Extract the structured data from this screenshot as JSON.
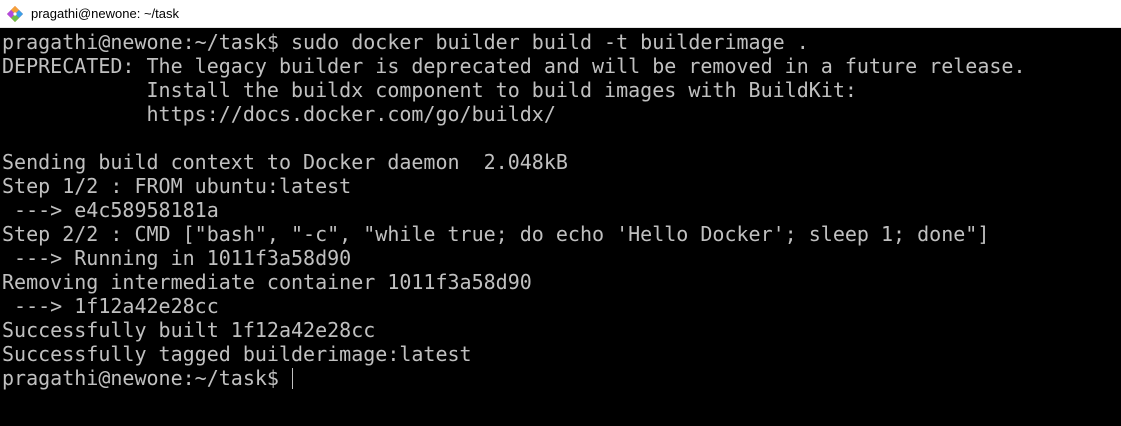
{
  "window": {
    "title": "pragathi@newone: ~/task",
    "icon": "git-bash-diamond-icon",
    "colors": {
      "background": "#000000",
      "text": "#c0c0c0",
      "titlebar": "#ffffff"
    }
  },
  "terminal": {
    "lines": [
      "pragathi@newone:~/task$ sudo docker builder build -t builderimage .",
      "DEPRECATED: The legacy builder is deprecated and will be removed in a future release.",
      "            Install the buildx component to build images with BuildKit:",
      "            https://docs.docker.com/go/buildx/",
      "",
      "Sending build context to Docker daemon  2.048kB",
      "Step 1/2 : FROM ubuntu:latest",
      " ---> e4c58958181a",
      "Step 2/2 : CMD [\"bash\", \"-c\", \"while true; do echo 'Hello Docker'; sleep 1; done\"]",
      " ---> Running in 1011f3a58d90",
      "Removing intermediate container 1011f3a58d90",
      " ---> 1f12a42e28cc",
      "Successfully built 1f12a42e28cc",
      "Successfully tagged builderimage:latest"
    ],
    "prompt": "pragathi@newone:~/task$ "
  }
}
